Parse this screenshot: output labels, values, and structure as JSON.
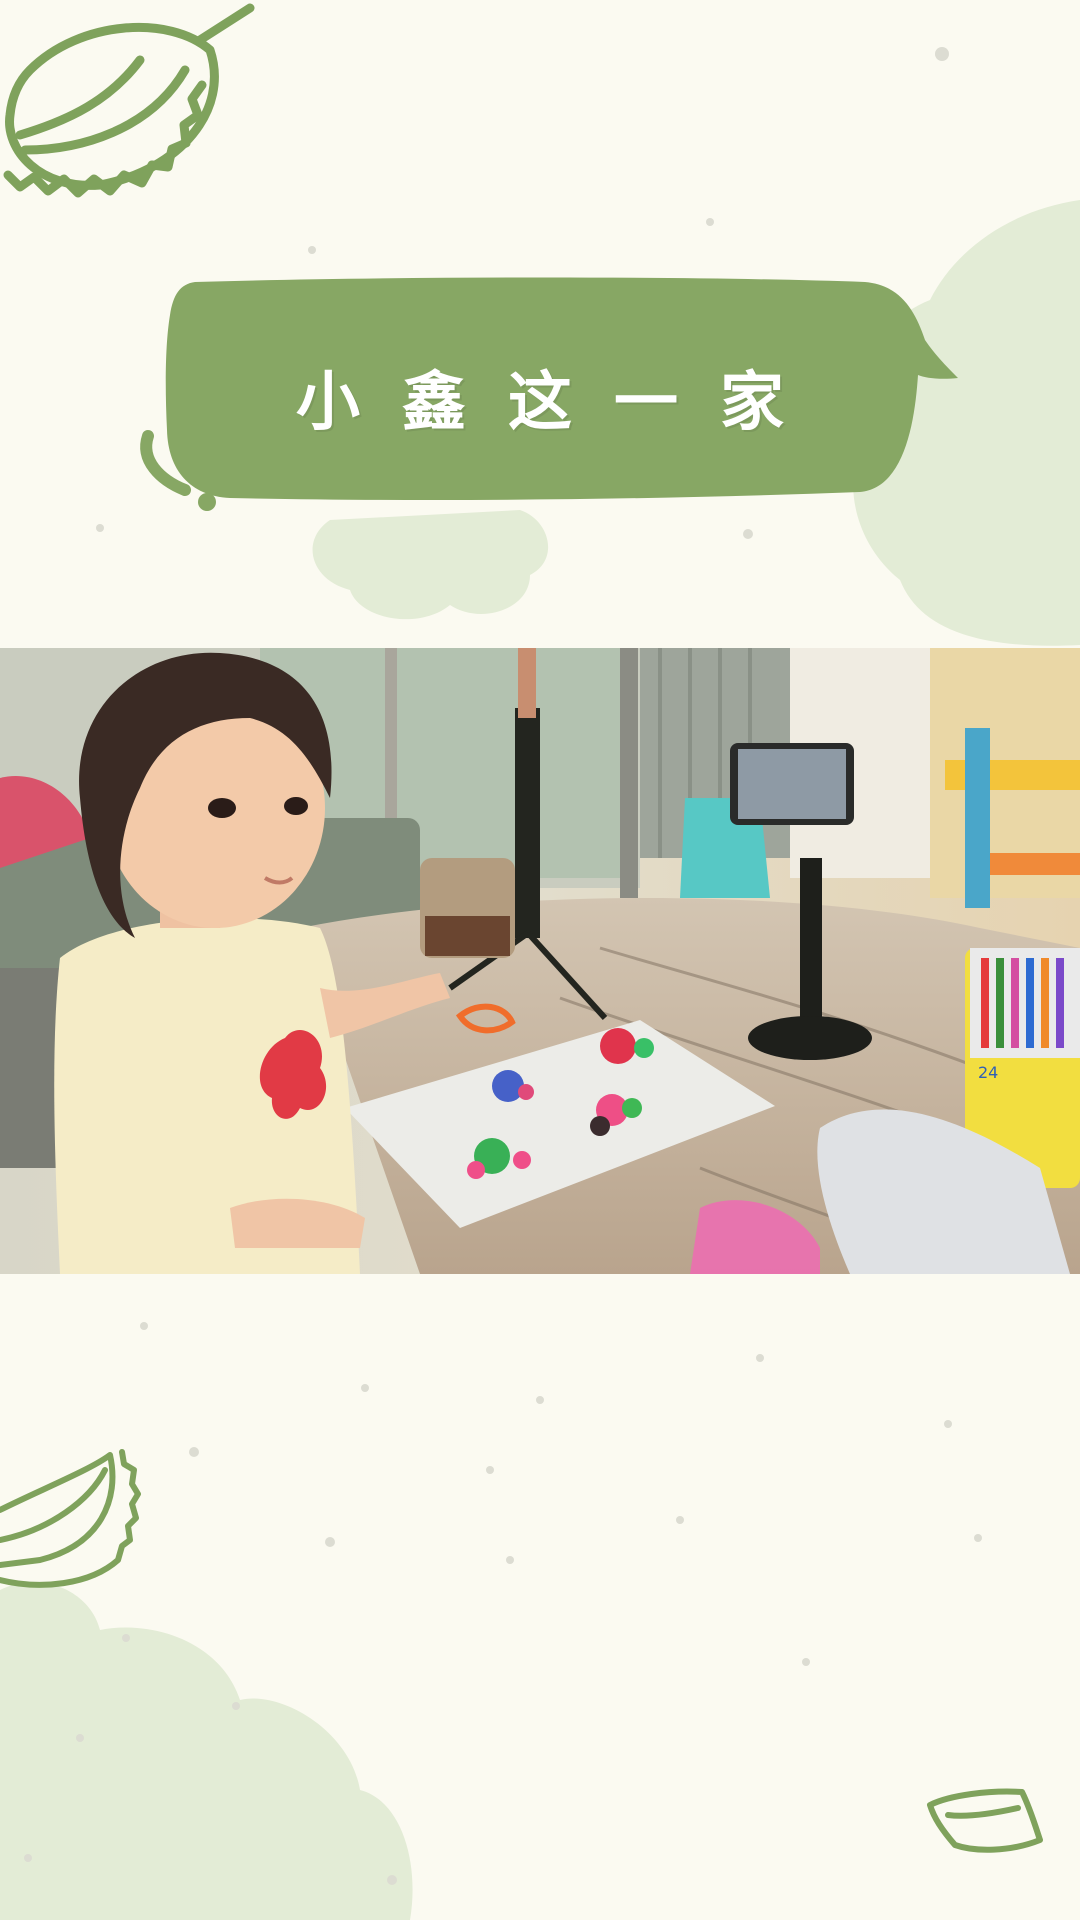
{
  "title": {
    "text": "小鑫这一家",
    "bubble_color": "#87a764",
    "text_color": "#ffffff"
  },
  "theme": {
    "background": "#fbfaf1",
    "cloud_color": "#e3ecd6",
    "line_art_color": "#7fa25c",
    "dot_color": "#dfe0d6"
  },
  "decor": {
    "top_left_icon": "durian-icon",
    "mid_left_icon": "durian-half-icon",
    "bottom_right_icon": "durian-piece-icon"
  },
  "photo": {
    "subject": "child-with-clay-crafts",
    "marker_label": "24"
  }
}
